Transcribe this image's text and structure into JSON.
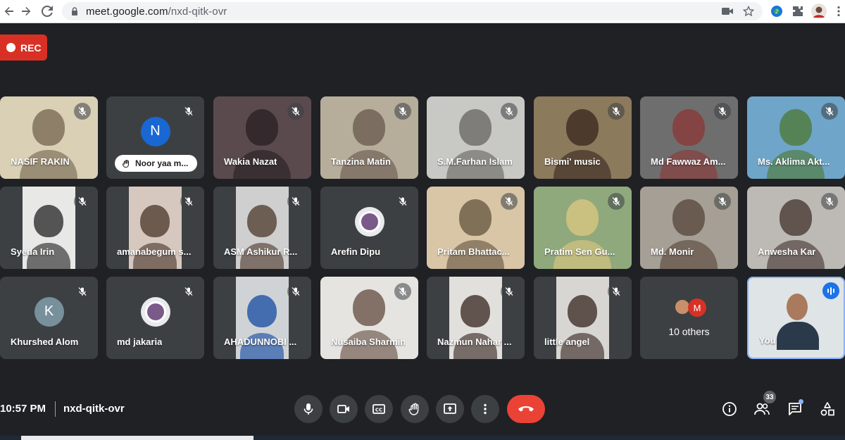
{
  "browser": {
    "url_host": "meet.google.com",
    "url_path": "/nxd-qitk-ovr"
  },
  "recording": {
    "label": "REC"
  },
  "participants": [
    {
      "name": "NASIF RAKIN",
      "muted": true,
      "bg": "#d9d0b6",
      "fg": "#7a6a55"
    },
    {
      "name": "Noor yaa m...",
      "muted": true,
      "avatar_letter": "N",
      "avatar_color": "#1967d2",
      "hand_raised": true
    },
    {
      "name": "Wakia Nazat",
      "muted": true,
      "bg": "#5a4a4e",
      "fg": "#2a2226"
    },
    {
      "name": "Tanzina Matin",
      "muted": true,
      "bg": "#b7ad9b",
      "fg": "#6b5e51"
    },
    {
      "name": "S.M.Farhan Islam",
      "muted": true,
      "bg": "#c8c8c4",
      "fg": "#6d6a66"
    },
    {
      "name": "Bismi' music",
      "muted": true,
      "bg": "#8c7a5c",
      "fg": "#3c2c22"
    },
    {
      "name": "Md Fawwaz Am...",
      "muted": true,
      "bg": "#6e6e6e",
      "fg": "#8a3a3a"
    },
    {
      "name": "Ms. Aklima Akt...",
      "muted": true,
      "bg": "#6fa5c9",
      "fg": "#4f7a3a"
    },
    {
      "name": "Syeda Irin",
      "muted": true,
      "bg": "#e8e8e6",
      "fg": "#3a3a3a",
      "narrow": true
    },
    {
      "name": "amanabegum s...",
      "muted": true,
      "bg": "#d6c8be",
      "fg": "#5a463c",
      "narrow": true
    },
    {
      "name": "ASM Ashikur R...",
      "muted": true,
      "bg": "#cfcfcf",
      "fg": "#5c4a3e",
      "narrow": true
    },
    {
      "name": "Arefin Dipu",
      "muted": true,
      "avatar_photo": true
    },
    {
      "name": "Pritam Bhattac...",
      "muted": true,
      "bg": "#d8c6a6",
      "fg": "#6b5a45"
    },
    {
      "name": "Pratim Sen Gu...",
      "muted": true,
      "bg": "#8fa97c",
      "fg": "#d8c680"
    },
    {
      "name": "Md. Monir",
      "muted": true,
      "bg": "#a59f96",
      "fg": "#5a4a3e"
    },
    {
      "name": "Anwesha Kar",
      "muted": true,
      "bg": "#bdbab5",
      "fg": "#4a3a35"
    },
    {
      "name": "Khurshed Alom",
      "muted": true,
      "avatar_letter": "K",
      "avatar_color": "#78909c"
    },
    {
      "name": "md jakaria",
      "muted": true,
      "avatar_photo": true
    },
    {
      "name": "AHADUNNOBI ...",
      "muted": true,
      "bg": "#d0d3d6",
      "fg": "#2a5aa8",
      "narrow": true
    },
    {
      "name": "Nusaiba Sharmin",
      "muted": true,
      "bg": "#e6e4e0",
      "fg": "#6a5448"
    },
    {
      "name": "Nazmun Nahar ...",
      "muted": true,
      "bg": "#e2e0dc",
      "fg": "#4a3a35",
      "narrow": true
    },
    {
      "name": "little angel",
      "muted": true,
      "bg": "#d8d6d2",
      "fg": "#4a3a35",
      "narrow": true
    },
    {
      "name": "",
      "others": true
    },
    {
      "name": "You",
      "self": true,
      "bg": "#dfe4e6",
      "fg": "#2a3a4a"
    }
  ],
  "others_tile": {
    "label": "10 others",
    "letter": "M"
  },
  "bottom": {
    "time": "10:57 PM",
    "meeting_code": "nxd-qitk-ovr",
    "people_count": "33"
  },
  "colors": {
    "background": "#202124",
    "tile": "#3c4043",
    "end_call": "#ea4335",
    "rec": "#d93025",
    "accent": "#1a73e8"
  }
}
